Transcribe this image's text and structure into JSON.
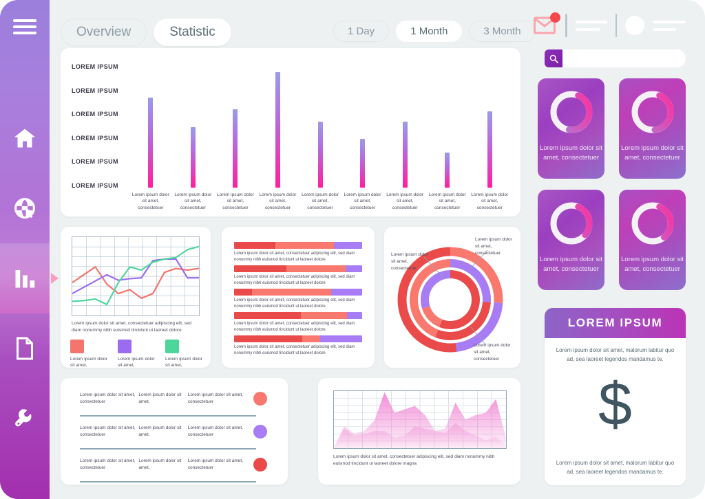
{
  "sidebar": {
    "menu_icon": "hamburger-icon",
    "items": [
      {
        "icon": "home-icon",
        "active": false
      },
      {
        "icon": "globe-cursor-icon",
        "active": false
      },
      {
        "icon": "bar-chart-icon",
        "active": true
      },
      {
        "icon": "document-icon",
        "active": false
      },
      {
        "icon": "wrench-icon",
        "active": false
      }
    ]
  },
  "header": {
    "tabs": [
      {
        "label": "Overview",
        "active": false
      },
      {
        "label": "Statistic",
        "active": true
      }
    ],
    "ranges": [
      {
        "label": "1 Day",
        "active": false
      },
      {
        "label": "1 Month",
        "active": true
      },
      {
        "label": "3 Month",
        "active": false
      }
    ],
    "mail_icon": "mail-icon",
    "notification_badge_color": "#f5484a",
    "avatar_icon": "avatar-icon",
    "search": {
      "icon": "search-icon",
      "placeholder": "",
      "value": ""
    }
  },
  "chart_data": [
    {
      "type": "bar",
      "name": "main-bar-chart",
      "title": "",
      "axis_labels": [
        "LOREM IPSUM",
        "LOREM IPSUM",
        "LOREM IPSUM",
        "LOREM IPSUM",
        "LOREM IPSUM",
        "LOREM IPSUM"
      ],
      "categories": [
        "Lorem ipsum dolor sit amet, consectetuer",
        "Lorem ipsum dolor sit amet, consectetuer",
        "Lorem ipsum dolor sit amet, consectetuer",
        "Lorem ipsum dolor sit amet, consectetuer",
        "Lorem ipsum dolor sit amet, consectetuer",
        "Lorem ipsum dolor sit amet, consectetuer",
        "Lorem ipsum dolor sit amet, consectetuer",
        "Lorem ipsum dolor sit amet, consectetuer",
        "Lorem ipsum dolor sit amet, consectetuer"
      ],
      "values": [
        78,
        52,
        68,
        100,
        57,
        42,
        57,
        30,
        66
      ],
      "ylim": [
        0,
        100
      ],
      "grid": false,
      "gradient_top": "#9b9be8",
      "gradient_bottom": "#ff1f9c"
    },
    {
      "type": "line",
      "name": "multi-line-chart",
      "caption": "Lorem ipsum dolor sit amet, consectetuer adipiscing elit, sed diam nonummy nibh euismod tincidunt ut laoreet dolore",
      "grid": true,
      "ylim": [
        0,
        100
      ],
      "series": [
        {
          "name": "Lorem ipsum dolor sit amet,",
          "color": "#f4756e",
          "values": [
            42,
            52,
            62,
            40,
            28,
            33,
            22,
            28,
            55,
            60,
            58,
            60
          ]
        },
        {
          "name": "Lorem ipsum dolor sit amet,",
          "color": "#9b6cf0",
          "values": [
            28,
            36,
            44,
            52,
            45,
            47,
            48,
            70,
            72,
            72,
            48,
            48
          ]
        },
        {
          "name": "Lorem ipsum dolor sit amet,",
          "color": "#4dd69c",
          "values": [
            18,
            19,
            21,
            14,
            42,
            62,
            58,
            68,
            72,
            74,
            84,
            88
          ]
        }
      ]
    },
    {
      "type": "bar",
      "name": "stacked-progress-bars",
      "orientation": "horizontal",
      "segment_colors": [
        "#ea4a4a",
        "#f9796f",
        "#a77cf5"
      ],
      "rows": [
        {
          "caption": "Lorem ipsum dolor sit amet, consectetuer adipiscing elit, sed diam nonummy nibh euismod tincidunt ut laoreet dolore",
          "segments": [
            32,
            46,
            22
          ]
        },
        {
          "caption": "Lorem ipsum dolor sit amet, consectetuer adipiscing elit, sed diam nonummy nibh euismod tincidunt ut laoreet dolore",
          "segments": [
            41,
            46,
            13
          ]
        },
        {
          "caption": "Lorem ipsum dolor sit amet, consectetuer adipiscing elit, sed diam nonummy nibh euismod tincidunt ut laoreet dolore",
          "segments": [
            14,
            62,
            24
          ]
        },
        {
          "caption": "Lorem ipsum dolor sit amet, consectetuer adipiscing elit, sed diam nonummy nibh euismod tincidunt ut laoreet dolore",
          "segments": [
            52,
            36,
            12
          ]
        },
        {
          "caption": "Lorem ipsum dolor sit amet, consectetuer adipiscing elit, sed diam nonummy nibh euismod tincidunt ut laoreet dolore",
          "segments": [
            53,
            14,
            33
          ]
        }
      ]
    },
    {
      "type": "pie",
      "name": "concentric-donut-chart",
      "rings": [
        {
          "name": "outer",
          "slices": [
            {
              "color": "#f9796f",
              "value": 26
            },
            {
              "color": "#a77cf5",
              "value": 22
            },
            {
              "color": "#ea4a4a",
              "value": 52
            }
          ]
        },
        {
          "name": "middle",
          "slices": [
            {
              "color": "#a77cf5",
              "value": 26
            },
            {
              "color": "#ea4a4a",
              "value": 30
            },
            {
              "color": "#f9796f",
              "value": 44
            }
          ]
        },
        {
          "name": "inner",
          "slices": [
            {
              "color": "#ea4a4a",
              "value": 56
            },
            {
              "color": "#f9796f",
              "value": 14
            },
            {
              "color": "#a77cf5",
              "value": 30
            }
          ]
        }
      ],
      "annotations": [
        "Lorem ipsum dolor sit amet, consectetuer",
        "Lorem ipsum dolor sit amet, consectetuer",
        "Lorem ipsum dolor sit amet, consectetuer"
      ]
    },
    {
      "type": "area",
      "name": "area-chart",
      "caption": "Lorem ipsum dolor sit amet, consectetuer adipiscing elit, sed diam nonummy nibh euismod tincidunt ut laoreet dolore magna",
      "grid": true,
      "series": [
        {
          "name": "series-back",
          "color": "#f07ad0",
          "values": [
            2,
            38,
            26,
            30,
            48,
            98,
            62,
            68,
            74,
            58,
            30,
            34,
            80,
            50,
            58,
            62,
            86,
            18
          ]
        },
        {
          "name": "series-front",
          "color": "#f5a8dd",
          "values": [
            2,
            34,
            22,
            24,
            30,
            30,
            18,
            22,
            38,
            34,
            30,
            26,
            44,
            30,
            22,
            14,
            20,
            4
          ]
        }
      ]
    }
  ],
  "gauges": [
    {
      "caption": "Lorem ipsum dolor sit amet, consectetuer",
      "percent": 46
    },
    {
      "caption": "Lorem ipsum dolor sit amet, consectetuer",
      "percent": 42
    },
    {
      "caption": "Lorem ipsum dolor sit amet, consectetuer",
      "percent": 30
    },
    {
      "caption": "Lorem ipsum dolor sit amet, consectetuer",
      "percent": 33
    }
  ],
  "table": {
    "rows": [
      {
        "col1": "Lorem ipsum dolor sit amet, consectetuer",
        "col2": "Lorem ipsum dolor sit amet,",
        "col3": "Lorem ipsum dolor sit amet, consectetuer",
        "dot_color": "#f9796f"
      },
      {
        "col1": "Lorem ipsum dolor sit amet, consectetuer",
        "col2": "Lorem ipsum dolor sit amet,",
        "col3": "Lorem ipsum dolor sit amet, consectetuer",
        "dot_color": "#a77cf5"
      },
      {
        "col1": "Lorem ipsum dolor sit amet, consectetuer",
        "col2": "Lorem ipsum dolor sit amet,",
        "col3": "Lorem ipsum dolor sit amet, consectetuer",
        "dot_color": "#ea4a4a"
      }
    ]
  },
  "panel": {
    "title": "LOREM IPSUM",
    "top_text": "Lorem ipsum dolor sit amet, malorum labitur quo ad, sea laoreet legendos mandamus te.",
    "symbol": "$",
    "bottom_text": "Lorem ipsum dolor sit amet, malorum labitur quo ad, sea laoreet legendos mandamus te."
  }
}
